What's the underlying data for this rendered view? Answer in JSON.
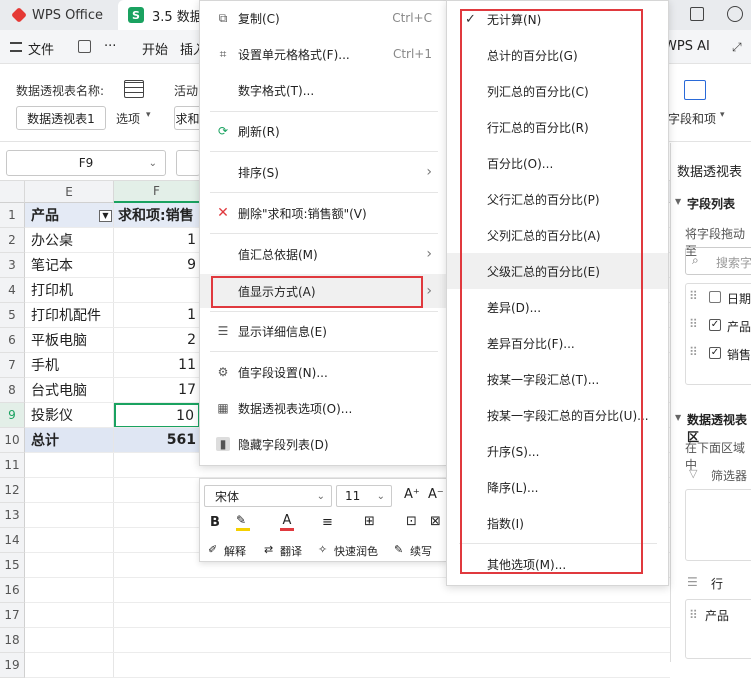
{
  "titlebar": {
    "home_tab": "WPS Office",
    "doc_tab": "3.5 数据",
    "doc_icon_letter": "S"
  },
  "menubar": {
    "file": "文件",
    "more": "···",
    "start": "开始",
    "insert": "插入",
    "wps_ai": "WPS AI"
  },
  "ribbon": {
    "pivot_name_label": "数据透视表名称:",
    "pivot_name_value": "数据透视表1",
    "options_label": "选项",
    "active_label": "活动",
    "active_value": "求和",
    "right_label": "字段和项"
  },
  "formula_bar": {
    "cell_ref": "F9"
  },
  "grid": {
    "col_e": "E",
    "col_f": "F",
    "rows": [
      {
        "num": "1",
        "e": "产品",
        "f": "求和项:销售",
        "header": true
      },
      {
        "num": "2",
        "e": "办公桌",
        "f": "1"
      },
      {
        "num": "3",
        "e": "笔记本",
        "f": "9"
      },
      {
        "num": "4",
        "e": "打印机",
        "f": ""
      },
      {
        "num": "5",
        "e": "打印机配件",
        "f": "1"
      },
      {
        "num": "6",
        "e": "平板电脑",
        "f": "2"
      },
      {
        "num": "7",
        "e": "手机",
        "f": "11"
      },
      {
        "num": "8",
        "e": "台式电脑",
        "f": "17"
      },
      {
        "num": "9",
        "e": "投影仪",
        "f": "10"
      },
      {
        "num": "10",
        "e": "总计",
        "f": "561",
        "total": true
      },
      {
        "num": "11",
        "e": "",
        "f": ""
      },
      {
        "num": "12",
        "e": "",
        "f": ""
      },
      {
        "num": "13",
        "e": "",
        "f": ""
      },
      {
        "num": "14",
        "e": "",
        "f": ""
      },
      {
        "num": "15",
        "e": "",
        "f": ""
      },
      {
        "num": "16",
        "e": "",
        "f": ""
      },
      {
        "num": "17",
        "e": "",
        "f": ""
      },
      {
        "num": "18",
        "e": "",
        "f": ""
      },
      {
        "num": "19",
        "e": "",
        "f": ""
      }
    ]
  },
  "pane": {
    "title": "数据透视表",
    "field_list": "字段列表",
    "drag_hint": "将字段拖动至",
    "search_placeholder": "搜索字",
    "fields": [
      "日期",
      "产品",
      "销售"
    ],
    "area_title": "数据透视表区",
    "area_hint": "在下面区域中",
    "filter": "筛选器",
    "row": "行",
    "row_item": "产品"
  },
  "context_menu": {
    "copy": "复制(C)",
    "copy_shortcut": "Ctrl+C",
    "format_cells": "设置单元格格式(F)...",
    "format_shortcut": "Ctrl+1",
    "number_format": "数字格式(T)...",
    "refresh": "刷新(R)",
    "sort": "排序(S)",
    "delete": "删除\"求和项:销售额\"(V)",
    "summarize_by": "值汇总依据(M)",
    "show_values_as": "值显示方式(A)",
    "show_details": "显示详细信息(E)",
    "field_settings": "值字段设置(N)...",
    "pivot_options": "数据透视表选项(O)...",
    "hide_field_list": "隐藏字段列表(D)"
  },
  "mini_toolbar": {
    "font": "宋体",
    "size": "11",
    "explain": "解释",
    "translate": "翻译",
    "polish": "快速润色",
    "continue": "续写"
  },
  "submenu": {
    "items": [
      "无计算(N)",
      "总计的百分比(G)",
      "列汇总的百分比(C)",
      "行汇总的百分比(R)",
      "百分比(O)...",
      "父行汇总的百分比(P)",
      "父列汇总的百分比(A)",
      "父级汇总的百分比(E)",
      "差异(D)...",
      "差异百分比(F)...",
      "按某一字段汇总(T)...",
      "按某一字段汇总的百分比(U)...",
      "升序(S)...",
      "降序(L)...",
      "指数(I)",
      "其他选项(M)..."
    ]
  },
  "colors": {
    "highlight_red": "#e0393e",
    "accent_green": "#1aa260",
    "total_row_bg": "#dfe6f3"
  }
}
